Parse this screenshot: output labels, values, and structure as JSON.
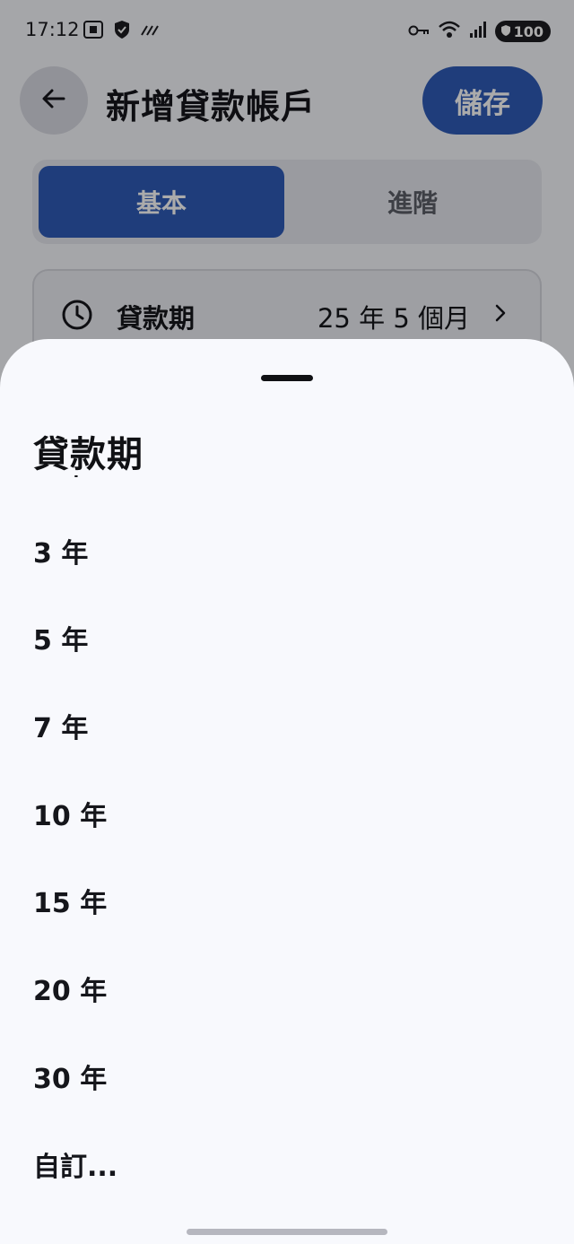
{
  "status_bar": {
    "time": "17:12",
    "battery": "100"
  },
  "app_bar": {
    "title": "新增貸款帳戶",
    "save_label": "儲存"
  },
  "tabs": [
    {
      "label": "基本",
      "selected": true
    },
    {
      "label": "進階",
      "selected": false
    }
  ],
  "loan_term_row": {
    "label": "貸款期",
    "value": "25 年 5 個月"
  },
  "sheet": {
    "title": "貸款期",
    "options": [
      "3 年",
      "5 年",
      "7 年",
      "10 年",
      "15 年",
      "20 年",
      "30 年",
      "自訂..."
    ]
  },
  "colors": {
    "accent": "#2f5bb8",
    "sheet_background": "#f8f9fd",
    "text_primary": "#15161b"
  }
}
